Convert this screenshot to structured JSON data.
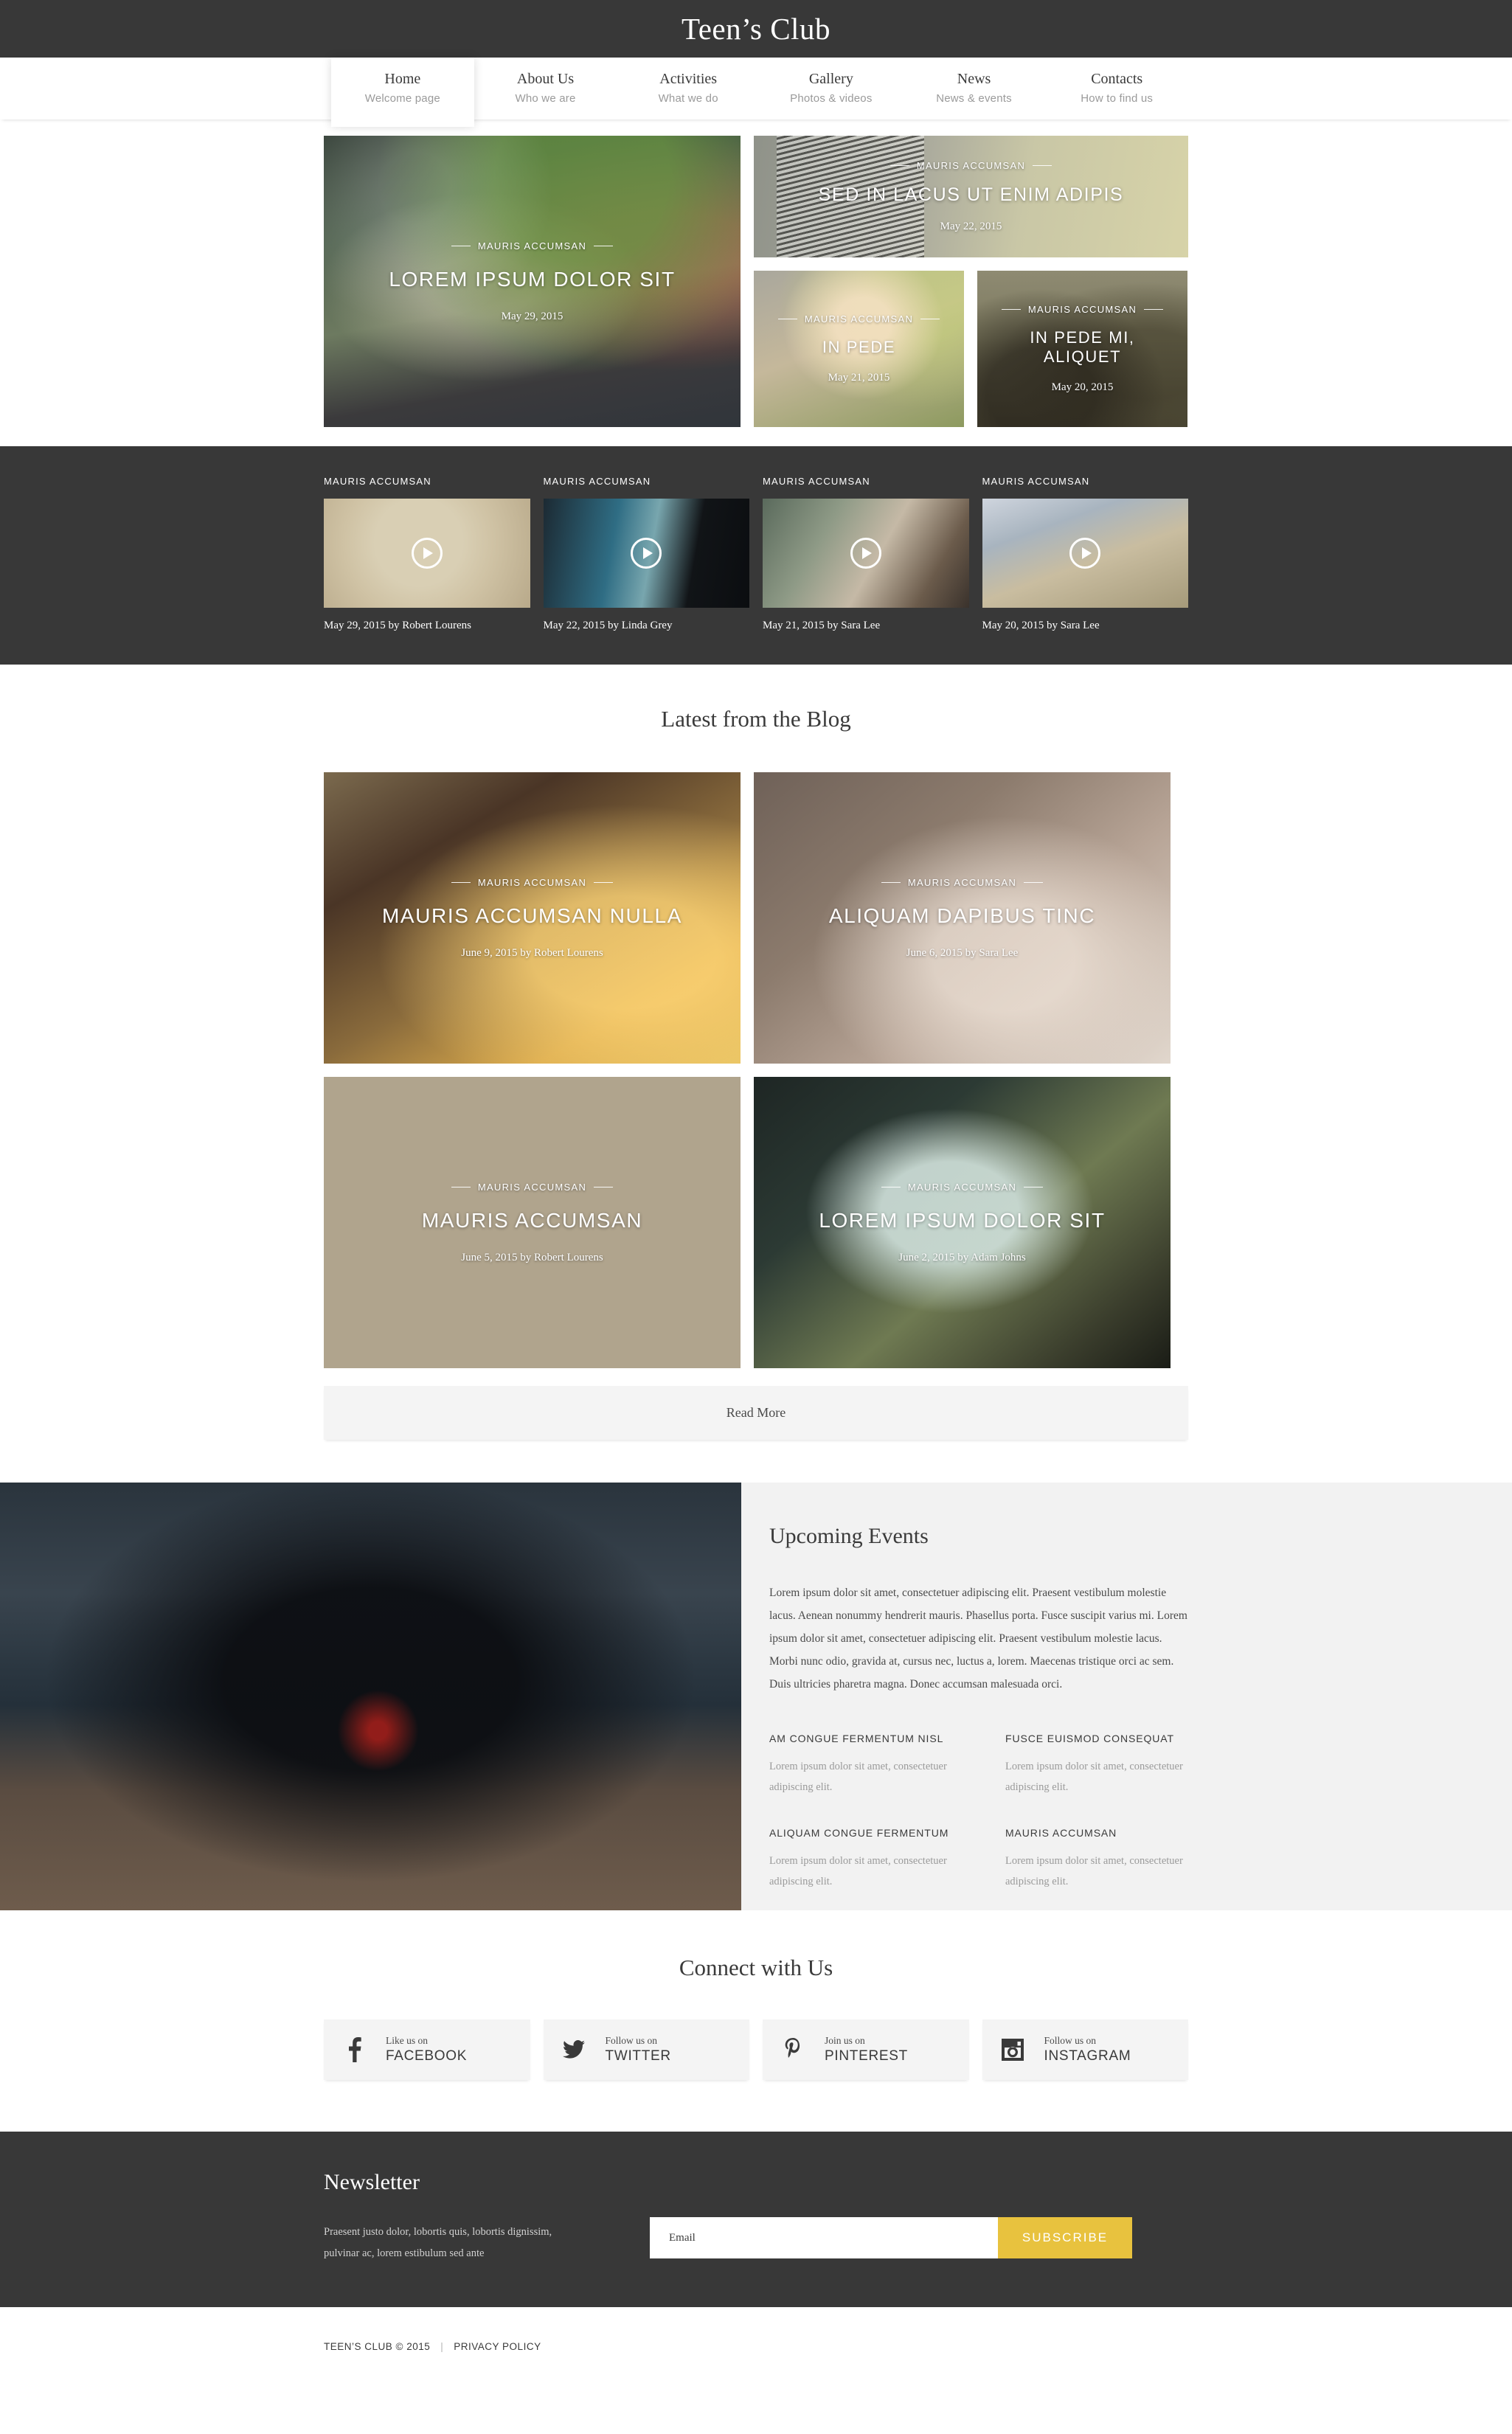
{
  "header": {
    "site_title": "Teen’s Club"
  },
  "nav": {
    "items": [
      {
        "title": "Home",
        "sub": "Welcome page",
        "active": true
      },
      {
        "title": "About Us",
        "sub": "Who we are",
        "active": false
      },
      {
        "title": "Activities",
        "sub": "What we do",
        "active": false
      },
      {
        "title": "Gallery",
        "sub": "Photos & videos",
        "active": false
      },
      {
        "title": "News",
        "sub": "News & events",
        "active": false
      },
      {
        "title": "Contacts",
        "sub": "How to find us",
        "active": false
      }
    ]
  },
  "hero": {
    "featured": {
      "kicker": "MAURIS ACCUMSAN",
      "title": "LOREM IPSUM DOLOR SIT",
      "date": "May 29, 2015"
    },
    "wide": {
      "kicker": "MAURIS ACCUMSAN",
      "title": "SED IN LACUS UT ENIM ADIPIS",
      "date": "May 22, 2015"
    },
    "small": [
      {
        "kicker": "MAURIS ACCUMSAN",
        "title": "IN PEDE",
        "date": "May 21, 2015"
      },
      {
        "kicker": "MAURIS ACCUMSAN",
        "title": "IN PEDE MI, ALIQUET",
        "date": "May 20, 2015"
      }
    ]
  },
  "videos": {
    "items": [
      {
        "category": "MAURIS ACCUMSAN",
        "meta": "May 29, 2015 by Robert Lourens"
      },
      {
        "category": "MAURIS ACCUMSAN",
        "meta": "May 22, 2015 by Linda Grey"
      },
      {
        "category": "MAURIS ACCUMSAN",
        "meta": "May 21, 2015 by Sara Lee"
      },
      {
        "category": "MAURIS ACCUMSAN",
        "meta": "May 20, 2015 by Sara Lee"
      }
    ]
  },
  "blog": {
    "title": "Latest from the Blog",
    "posts": [
      {
        "kicker": "MAURIS ACCUMSAN",
        "title": "MAURIS ACCUMSAN NULLA",
        "meta": "June 9, 2015 by Robert Lourens"
      },
      {
        "kicker": "MAURIS ACCUMSAN",
        "title": "ALIQUAM DAPIBUS TINC",
        "meta": "June 6, 2015 by Sara Lee"
      },
      {
        "kicker": "MAURIS ACCUMSAN",
        "title": "MAURIS ACCUMSAN",
        "meta": "June 5, 2015 by Robert Lourens"
      },
      {
        "kicker": "MAURIS ACCUMSAN",
        "title": "LOREM IPSUM DOLOR SIT",
        "meta": "June 2, 2015 by Adam Johns"
      }
    ],
    "read_more": "Read More"
  },
  "events": {
    "title": "Upcoming Events",
    "intro": "Lorem ipsum dolor sit amet, consectetuer adipiscing elit. Praesent vestibulum molestie lacus. Aenean nonummy hendrerit mauris. Phasellus porta. Fusce suscipit varius mi. Lorem ipsum dolor sit amet, consectetuer adipiscing elit. Praesent vestibulum molestie lacus. Morbi nunc odio, gravida at, cursus nec, luctus a, lorem. Maecenas tristique orci ac sem. Duis ultricies pharetra magna. Donec accumsan malesuada orci.",
    "items": [
      {
        "name": "AM CONGUE FERMENTUM NISL",
        "text": "Lorem ipsum dolor sit amet, consectetuer adipiscing elit."
      },
      {
        "name": "FUSCE EUISMOD CONSEQUAT",
        "text": "Lorem ipsum dolor sit amet, consectetuer adipiscing elit."
      },
      {
        "name": "ALIQUAM CONGUE FERMENTUM",
        "text": "Lorem ipsum dolor sit amet, consectetuer adipiscing elit."
      },
      {
        "name": "MAURIS ACCUMSAN",
        "text": "Lorem ipsum dolor sit amet, consectetuer adipiscing elit."
      }
    ]
  },
  "social": {
    "title": "Connect with Us",
    "items": [
      {
        "icon": "facebook-icon",
        "small": "Like us on",
        "name": "FACEBOOK"
      },
      {
        "icon": "twitter-icon",
        "small": "Follow us on",
        "name": "TWITTER"
      },
      {
        "icon": "pinterest-icon",
        "small": "Join us on",
        "name": "PINTEREST"
      },
      {
        "icon": "instagram-icon",
        "small": "Follow us on",
        "name": "INSTAGRAM"
      }
    ]
  },
  "newsletter": {
    "title": "Newsletter",
    "description": "Praesent justo dolor, lobortis quis, lobortis dignissim, pulvinar ac, lorem estibulum sed ante",
    "email_placeholder": "Email",
    "email_value": "",
    "submit_label": "SUBSCRIBE",
    "accent_color": "#E8C23E"
  },
  "footer": {
    "copyright": "TEEN’S CLUB © 2015",
    "separator": "|",
    "privacy": "PRIVACY POLICY"
  }
}
